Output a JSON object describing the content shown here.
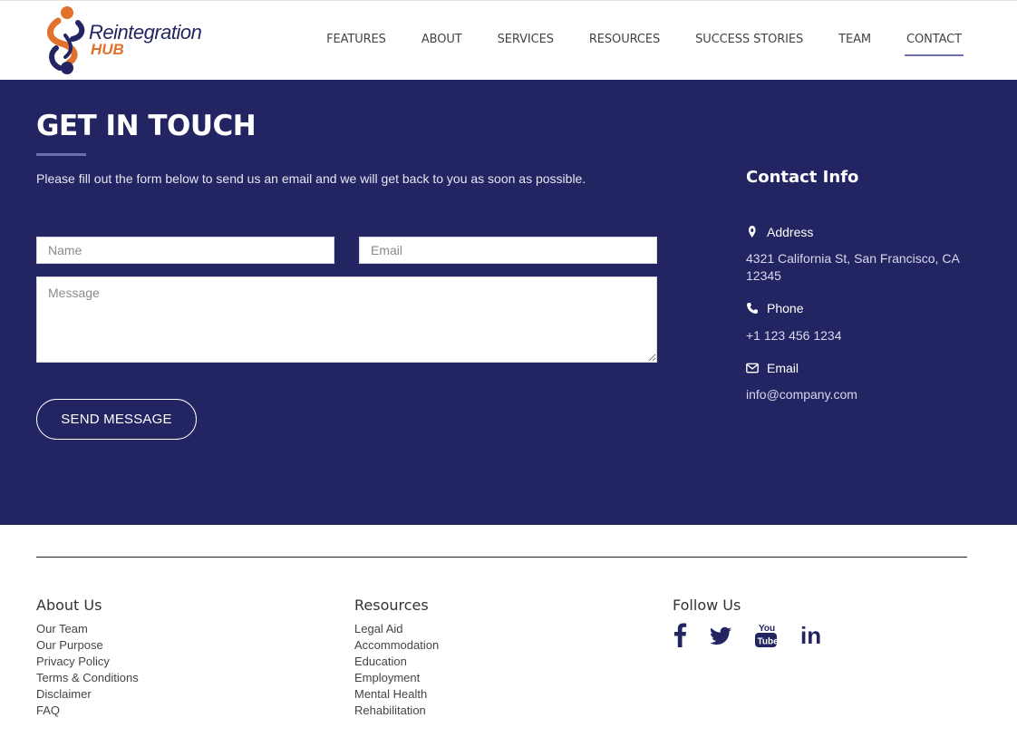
{
  "brand": {
    "name_line1": "Reintegration",
    "name_line2": "HUB"
  },
  "nav": {
    "items": [
      {
        "label": "FEATURES"
      },
      {
        "label": "ABOUT"
      },
      {
        "label": "SERVICES"
      },
      {
        "label": "RESOURCES"
      },
      {
        "label": "SUCCESS STORIES"
      },
      {
        "label": "TEAM"
      },
      {
        "label": "CONTACT",
        "active": true
      }
    ]
  },
  "contact": {
    "heading": "GET IN TOUCH",
    "intro": "Please fill out the form below to send us an email and we will get back to you as soon as possible.",
    "form": {
      "name_placeholder": "Name",
      "email_placeholder": "Email",
      "message_placeholder": "Message",
      "name_value": "",
      "email_value": "",
      "message_value": "",
      "send_label": "SEND MESSAGE"
    },
    "info": {
      "title": "Contact Info",
      "address_label": "Address",
      "address_value": "4321 California St, San Francisco, CA 12345",
      "phone_label": "Phone",
      "phone_value": "+1 123 456 1234",
      "email_label": "Email",
      "email_value": "info@company.com"
    }
  },
  "footer": {
    "about": {
      "title": "About Us",
      "links": [
        "Our Team",
        "Our Purpose",
        "Privacy Policy",
        "Terms & Conditions",
        "Disclaimer",
        "FAQ"
      ]
    },
    "resources": {
      "title": "Resources",
      "links": [
        "Legal Aid",
        "Accommodation",
        "Education",
        "Employment",
        "Mental Health",
        "Rehabilitation"
      ]
    },
    "follow": {
      "title": "Follow Us",
      "icons": [
        "facebook-icon",
        "twitter-icon",
        "youtube-icon",
        "linkedin-icon"
      ],
      "youtube_line1": "You",
      "youtube_line2": "Tube",
      "linkedin_text": "in"
    }
  },
  "colors": {
    "primary_navy": "#222561",
    "accent_orange": "#e2712b",
    "nav_underline": "#6b6fb0"
  }
}
